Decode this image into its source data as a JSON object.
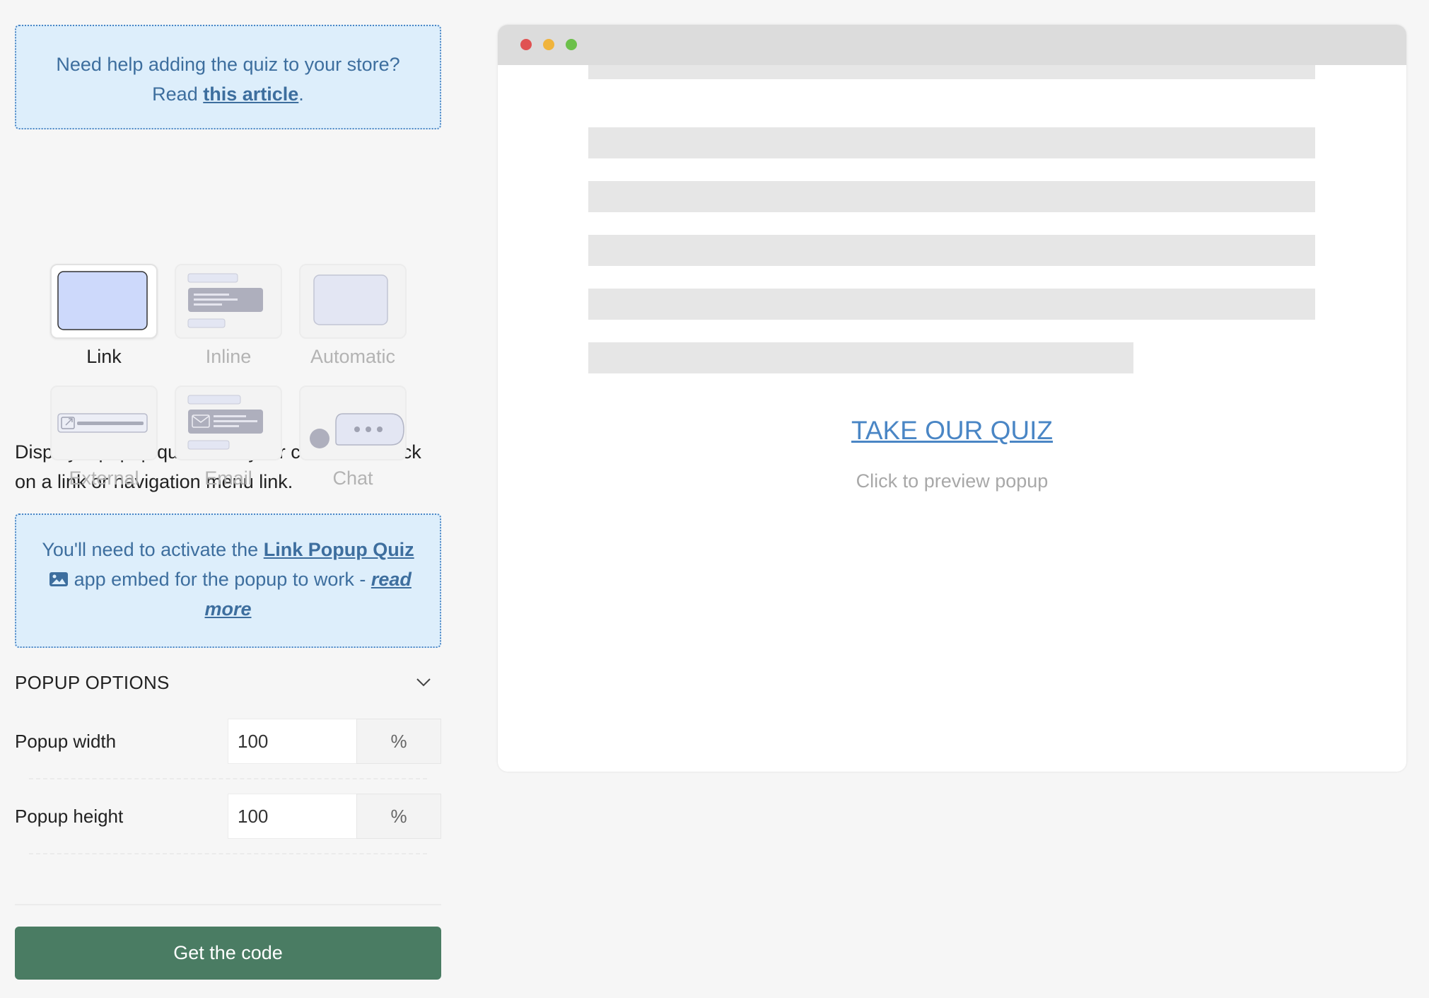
{
  "help_notice": {
    "line1": "Need help adding the quiz to your store?",
    "read_prefix": "Read ",
    "link_text": "this article",
    "suffix": "."
  },
  "quiz_types": [
    {
      "label": "Link",
      "selected": true,
      "icon": "link-popup-icon"
    },
    {
      "label": "Inline",
      "selected": false,
      "icon": "inline-embed-icon"
    },
    {
      "label": "Automatic",
      "selected": false,
      "icon": "automatic-popup-icon"
    },
    {
      "label": "External",
      "selected": false,
      "icon": "external-link-icon"
    },
    {
      "label": "Email",
      "selected": false,
      "icon": "email-icon"
    },
    {
      "label": "Chat",
      "selected": false,
      "icon": "chat-bubble-icon"
    }
  ],
  "description": "Display a popup quiz when your customers click on a link or navigation menu link.",
  "embed_notice": {
    "prefix": "You'll need to activate the ",
    "link_text": "Link Popup Quiz ",
    "middle": " app embed for the popup to work - ",
    "read_more": "read more"
  },
  "popup_options": {
    "header": "POPUP OPTIONS",
    "fields": [
      {
        "label": "Popup width",
        "value": "100",
        "unit": "%"
      },
      {
        "label": "Popup height",
        "value": "100",
        "unit": "%"
      }
    ]
  },
  "cta_label": "Get the code",
  "preview": {
    "link_text": "TAKE OUR QUIZ",
    "hint": "Click to preview popup"
  },
  "colors": {
    "accent_green": "#4a7c63",
    "link_blue": "#4a86c5",
    "notice_bg": "#ddeefb",
    "window_dot_red": "#e05252",
    "window_dot_yellow": "#f0b43c",
    "window_dot_green": "#6cc04a"
  }
}
